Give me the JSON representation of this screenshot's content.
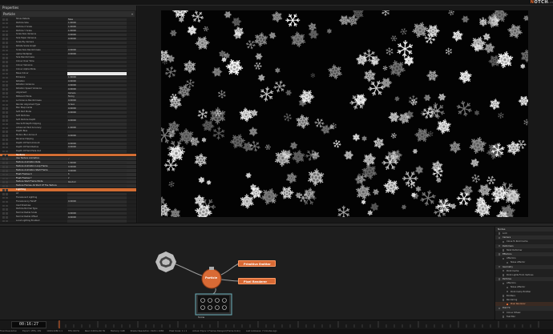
{
  "app": {
    "brand": "NOTCH",
    "brand_accent": "N",
    "version": "0.9.23"
  },
  "property_panel": {
    "title": "Properties",
    "node_selector": "Particle",
    "rows": [
      {
        "label": "Show Details",
        "value": "False",
        "kind": "plain"
      },
      {
        "label": "Particle Size",
        "value": "1.00000",
        "kind": "plain"
      },
      {
        "label": "Particle X Scale",
        "value": "1.00000",
        "kind": "plain"
      },
      {
        "label": "Particle Y Scale",
        "value": "1.00000",
        "kind": "plain"
      },
      {
        "label": "Scale Size Variance",
        "value": "0.00000",
        "kind": "plain"
      },
      {
        "label": "Size Taper Variance",
        "value": "0.00000",
        "kind": "plain"
      },
      {
        "label": "Scale By Camera",
        "value": "",
        "kind": "plain"
      },
      {
        "label": "Rotate Scale Graph",
        "value": "",
        "kind": "plain"
      },
      {
        "label": "Scale Size Randomness",
        "value": "0.00000",
        "kind": "plain"
      },
      {
        "label": "Alpha Multiplier",
        "value": "0.00000",
        "kind": "plain"
      },
      {
        "label": "Size Randomness",
        "value": "",
        "kind": "plain"
      },
      {
        "label": "Colour Over Time",
        "value": "",
        "kind": "plain"
      },
      {
        "label": "Colour Variance",
        "value": "",
        "kind": "plain"
      },
      {
        "label": "Colour Alpha Mode",
        "value": "",
        "kind": "plain"
      },
      {
        "label": "Base Colour",
        "value": "",
        "kind": "white"
      },
      {
        "label": "Emissive",
        "value": "1.00000",
        "kind": "plain"
      },
      {
        "label": "Rotation",
        "value": "0.00000",
        "kind": "plain"
      },
      {
        "label": "Rotation Variance",
        "value": "0.00000",
        "kind": "plain"
      },
      {
        "label": "Rotation Speed Variance",
        "value": "0.00000",
        "kind": "plain"
      },
      {
        "label": "Alignment",
        "value": "Camera",
        "kind": "plain"
      },
      {
        "label": "Billboard Mode",
        "value": "Facing",
        "kind": "plain"
      },
      {
        "label": "Luminance Randomness",
        "value": "0.00000",
        "kind": "plain"
      },
      {
        "label": "Render Alignment Type",
        "value": "Screen",
        "kind": "plain"
      },
      {
        "label": "Blur Map Inside",
        "value": "0.00000",
        "kind": "plain"
      },
      {
        "label": "Soft Part Mode",
        "value": "0.00000",
        "kind": "plain"
      },
      {
        "label": "Soft Particles",
        "value": "",
        "kind": "plain"
      },
      {
        "label": "Soft Particle Depth",
        "value": "0.00000",
        "kind": "plain"
      },
      {
        "label": "Use Soft Depth Clipping",
        "value": "",
        "kind": "plain"
      },
      {
        "label": "Advanced Text Accuracy",
        "value": "1.00000",
        "kind": "plain"
      },
      {
        "label": "Depth Bias",
        "value": "",
        "kind": "plain"
      },
      {
        "label": "Motion Blur Amount",
        "value": "0.00000",
        "kind": "plain"
      },
      {
        "label": "Reverse Clipping",
        "value": "",
        "kind": "plain"
      },
      {
        "label": "Depth Of Field Amount",
        "value": "0.00000",
        "kind": "plain"
      },
      {
        "label": "Depth Of Field Radius",
        "value": "0.00000",
        "kind": "plain"
      },
      {
        "label": "Depth Of Field Fade Out",
        "value": "",
        "kind": "plain"
      },
      {
        "label": "Texture",
        "value": "",
        "kind": "section"
      },
      {
        "label": "Use Texture Animation",
        "value": "✓",
        "kind": "hl"
      },
      {
        "label": "Texture Animation Rate",
        "value": "1.00000",
        "kind": "hl"
      },
      {
        "label": "Texture Animation Loop Frame",
        "value": "0.00000",
        "kind": "hl"
      },
      {
        "label": "Texture Animation Start Frame",
        "value": "0.00000",
        "kind": "hl"
      },
      {
        "label": "Flash Frames X",
        "value": "6",
        "kind": "hl"
      },
      {
        "label": "Flash Frames Y",
        "value": "2",
        "kind": "hl"
      },
      {
        "label": "Texture Start Frame Mode",
        "value": "Random",
        "kind": "hl"
      },
      {
        "label": "Texture Frames All Start Of The Texture",
        "value": "",
        "kind": "hl"
      },
      {
        "label": "Lighting",
        "value": "",
        "kind": "section"
      },
      {
        "label": "Lit",
        "value": "",
        "kind": "plain"
      },
      {
        "label": "Translucent Lighting",
        "value": "",
        "kind": "plain"
      },
      {
        "label": "Translucency Falloff",
        "value": "0.00000",
        "kind": "plain"
      },
      {
        "label": "Cast Shadows",
        "value": "",
        "kind": "plain"
      },
      {
        "label": "Particle Normal Type",
        "value": "",
        "kind": "plain"
      },
      {
        "label": "Normal Radial Scale",
        "value": "0.00000",
        "kind": "plain"
      },
      {
        "label": "Normal Radial Offset",
        "value": "0.00000",
        "kind": "plain"
      },
      {
        "label": "Local Lighting Enabled",
        "value": "",
        "kind": "plain"
      }
    ]
  },
  "nodegraph": {
    "particle_label": "Particle",
    "emitter_label": "Primitive Emitter",
    "renderer_label": "Pixel Renderer",
    "texture_label": "Snow",
    "colors": {
      "orange": "#d86a35",
      "node_bg": "#c9c9c9"
    }
  },
  "tree": {
    "title": "Nodes",
    "items": [
      {
        "label": "Lock",
        "depth": 0,
        "kind": "plain"
      },
      {
        "label": "Camera",
        "depth": 0,
        "kind": "hsec"
      },
      {
        "label": "Clone To Root Cache",
        "depth": 1,
        "kind": "plain"
      },
      {
        "label": "Deformers",
        "depth": 0,
        "kind": "hsec"
      },
      {
        "label": "Twist Deformer",
        "depth": 1,
        "kind": "plain"
      },
      {
        "label": "Effectors",
        "depth": 0,
        "kind": "hsec"
      },
      {
        "label": "Affectors",
        "depth": 1,
        "kind": "plain"
      },
      {
        "label": "Noise Affector",
        "depth": 2,
        "kind": "plain"
      },
      {
        "label": "Geometry",
        "depth": 0,
        "kind": "hsec"
      },
      {
        "label": "Point Cache",
        "depth": 1,
        "kind": "plain"
      },
      {
        "label": "Point Lights From Vertices",
        "depth": 1,
        "kind": "plain"
      },
      {
        "label": "Particles",
        "depth": 0,
        "kind": "hsec"
      },
      {
        "label": "Affectors",
        "depth": 1,
        "kind": "plain"
      },
      {
        "label": "Noise Affector",
        "depth": 2,
        "kind": "plain"
      },
      {
        "label": "Point Camp Emitter",
        "depth": 2,
        "kind": "plain"
      },
      {
        "label": "Emitters",
        "depth": 1,
        "kind": "plain"
      },
      {
        "label": "Rendering",
        "depth": 1,
        "kind": "plain"
      },
      {
        "label": "Pixel Renderer",
        "depth": 2,
        "kind": "sel"
      },
      {
        "label": "Post FX",
        "depth": 0,
        "kind": "hsec"
      },
      {
        "label": "Colour Wheel",
        "depth": 1,
        "kind": "plain"
      },
      {
        "label": "Fast Blur",
        "depth": 1,
        "kind": "plain"
      },
      {
        "label": "Surface Blur",
        "depth": 1,
        "kind": "plain"
      },
      {
        "label": "Video Processing",
        "depth": 0,
        "kind": "hsec"
      }
    ]
  },
  "timeline": {
    "timecode": "00:16:27"
  },
  "status": [
    "Fixed Resolution",
    "Export: 1FPS, 1Hz",
    "1920x1080 1:1",
    "FPS: 60 Hz",
    "Real: 0.00ms 60 Hz",
    "Memory: 1GB",
    "Shader Resolution: 1920 x 1080",
    "Pixel Scale: 1 x 1",
    "Actual: Equiv 1 Frames Delayed (Frame Unkn)",
    "Last Autosave: 7 minutes ago"
  ]
}
